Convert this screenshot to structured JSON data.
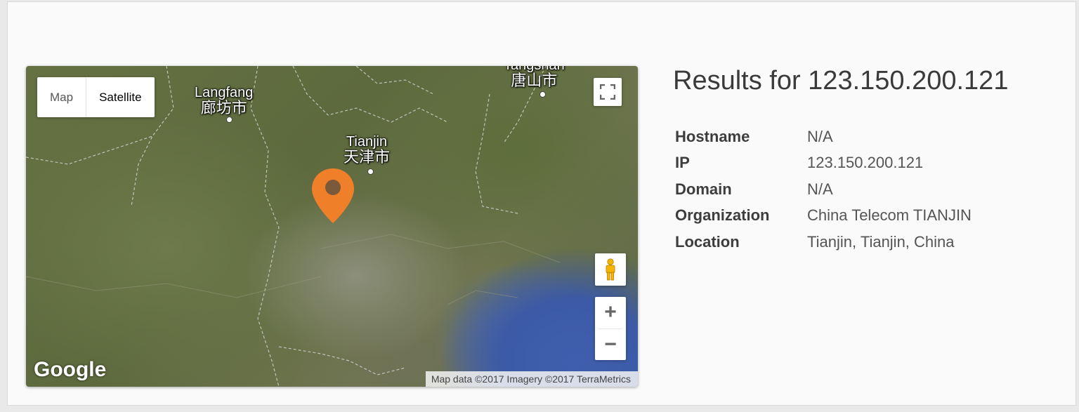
{
  "map": {
    "type_buttons": [
      "Map",
      "Satellite"
    ],
    "active_type": "Satellite",
    "cities": {
      "langfang": {
        "en": "Langfang",
        "zh": "廊坊市"
      },
      "tianjin": {
        "en": "Tianjin",
        "zh": "天津市"
      },
      "tangshan": {
        "en": "Tangshan",
        "zh": "唐山市"
      }
    },
    "logo": "Google",
    "attribution": "Map data ©2017 Imagery ©2017 TerraMetrics",
    "zoom_in": "+",
    "zoom_out": "−",
    "marker_color": "#f07f2a"
  },
  "results": {
    "title": "Results for 123.150.200.121",
    "rows": [
      {
        "label": "Hostname",
        "value": "N/A"
      },
      {
        "label": "IP",
        "value": "123.150.200.121"
      },
      {
        "label": "Domain",
        "value": "N/A"
      },
      {
        "label": "Organization",
        "value": "China Telecom TIANJIN"
      },
      {
        "label": "Location",
        "value": "Tianjin, Tianjin, China"
      }
    ]
  }
}
